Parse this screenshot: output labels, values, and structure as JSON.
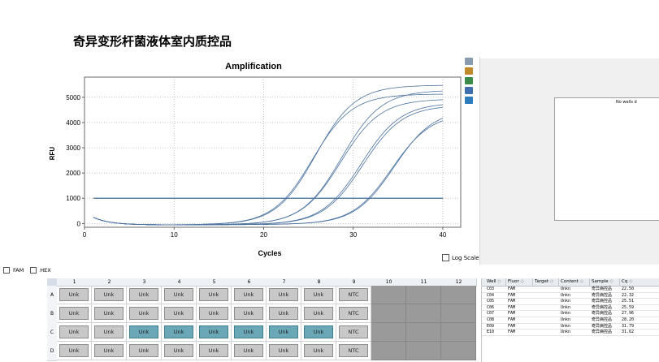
{
  "page": {
    "title": "奇异变形杆菌液体室内质控品"
  },
  "chart_data": {
    "type": "line",
    "title": "Amplification",
    "xlabel": "Cycles",
    "ylabel": "RFU",
    "xlim": [
      0,
      42
    ],
    "ylim": [
      -150,
      5800
    ],
    "xticks": [
      0,
      10,
      20,
      30,
      40
    ],
    "yticks": [
      0,
      1000,
      2000,
      3000,
      4000,
      5000
    ],
    "grid": true,
    "threshold": 1000,
    "series": [
      {
        "cq": 22.5,
        "max": 5500
      },
      {
        "cq": 22.32,
        "max": 5150
      },
      {
        "cq": 25.51,
        "max": 5300
      },
      {
        "cq": 25.59,
        "max": 4950
      },
      {
        "cq": 27.96,
        "max": 4800
      },
      {
        "cq": 28.2,
        "max": 4700
      },
      {
        "cq": 31.79,
        "max": 4550
      },
      {
        "cq": 31.62,
        "max": 4400
      }
    ]
  },
  "chart_options": {
    "log_scale_label": "Log Scale"
  },
  "side_tools": [
    {
      "icon": "copy-icon",
      "color": "#8a9bb0"
    },
    {
      "icon": "print-icon",
      "color": "#c08a2a"
    },
    {
      "icon": "save-image-icon",
      "color": "#3a8a4a"
    },
    {
      "icon": "export-icon",
      "color": "#3f6fb0"
    },
    {
      "icon": "trend-icon",
      "color": "#2b7bbd"
    }
  ],
  "right_panel": {
    "message": "No wells d"
  },
  "fluorophores": [
    {
      "label": "FAM"
    },
    {
      "label": "HEX"
    }
  ],
  "plate": {
    "columns": [
      "1",
      "2",
      "3",
      "4",
      "5",
      "6",
      "7",
      "8",
      "9",
      "10",
      "11",
      "12"
    ],
    "rows": [
      {
        "label": "A",
        "wells": [
          "Unk",
          "Unk",
          "Unk",
          "Unk",
          "Unk",
          "Unk",
          "Unk",
          "Unk",
          "NTC",
          "",
          "",
          ""
        ],
        "selected": []
      },
      {
        "label": "B",
        "wells": [
          "Unk",
          "Unk",
          "Unk",
          "Unk",
          "Unk",
          "Unk",
          "Unk",
          "Unk",
          "NTC",
          "",
          "",
          ""
        ],
        "selected": []
      },
      {
        "label": "C",
        "wells": [
          "Unk",
          "Unk",
          "Unk",
          "Unk",
          "Unk",
          "Unk",
          "Unk",
          "Unk",
          "NTC",
          "",
          "",
          ""
        ],
        "selected": [
          2,
          3,
          4,
          5,
          6,
          7
        ]
      },
      {
        "label": "D",
        "wells": [
          "Unk",
          "Unk",
          "Unk",
          "Unk",
          "Unk",
          "Unk",
          "Unk",
          "Unk",
          "NTC",
          "",
          "",
          ""
        ],
        "selected": []
      }
    ]
  },
  "results_table": {
    "headers": [
      "Well",
      "Fluor",
      "Target",
      "Content",
      "Sample",
      "Cq"
    ],
    "rows": [
      {
        "well": "C03",
        "fluor": "FAM",
        "target": "",
        "content": "Unkn",
        "sample": "奇异病控品",
        "cq": "22.50"
      },
      {
        "well": "C04",
        "fluor": "FAM",
        "target": "",
        "content": "Unkn",
        "sample": "奇异病控品",
        "cq": "22.32"
      },
      {
        "well": "C05",
        "fluor": "FAM",
        "target": "",
        "content": "Unkn",
        "sample": "奇异病控品",
        "cq": "25.51"
      },
      {
        "well": "C06",
        "fluor": "FAM",
        "target": "",
        "content": "Unkn",
        "sample": "奇异病控品",
        "cq": "25.59"
      },
      {
        "well": "C07",
        "fluor": "FAM",
        "target": "",
        "content": "Unkn",
        "sample": "奇异病控品",
        "cq": "27.96"
      },
      {
        "well": "C08",
        "fluor": "FAM",
        "target": "",
        "content": "Unkn",
        "sample": "奇异病控品",
        "cq": "28.20"
      },
      {
        "well": "E09",
        "fluor": "FAM",
        "target": "",
        "content": "Unkn",
        "sample": "奇异病控品",
        "cq": "31.79"
      },
      {
        "well": "E10",
        "fluor": "FAM",
        "target": "",
        "content": "Unkn",
        "sample": "奇异病控品",
        "cq": "31.62"
      }
    ]
  }
}
